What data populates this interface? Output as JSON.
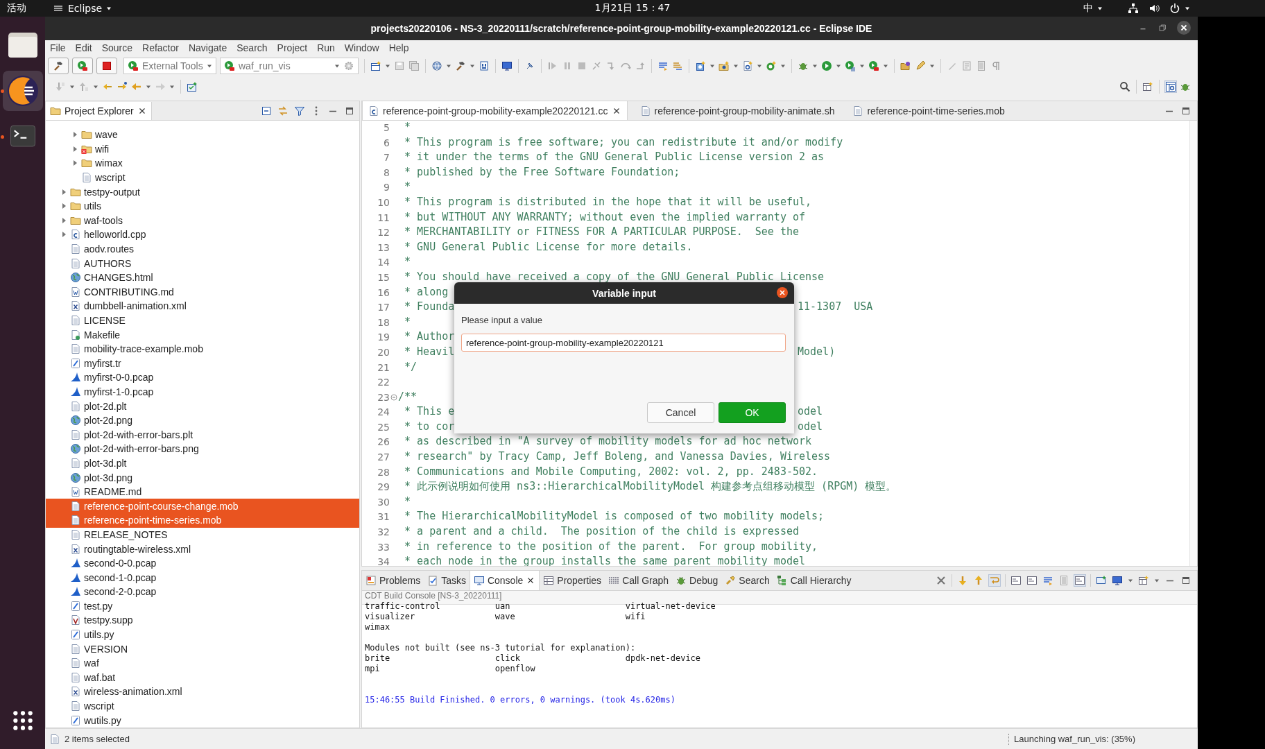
{
  "topbar": {
    "activities": "活动",
    "app": "Eclipse",
    "clock": "1月21日 15：47",
    "input_method": "中"
  },
  "window": {
    "title": "projects20220106 - NS-3_20220111/scratch/reference-point-group-mobility-example20220121.cc - Eclipse IDE"
  },
  "menu": [
    "File",
    "Edit",
    "Source",
    "Refactor",
    "Navigate",
    "Search",
    "Project",
    "Run",
    "Window",
    "Help"
  ],
  "toolbar": {
    "external_tools": "External Tools",
    "launch_config": "waf_run_vis"
  },
  "explorer": {
    "title": "Project Explorer",
    "tree": [
      {
        "children": [
          {
            "label": "wave",
            "kind": "folder",
            "expanded": false,
            "selected": false
          },
          {
            "label": "wifi",
            "kind": "folder_error",
            "expanded": false,
            "selected": false
          },
          {
            "label": "wimax",
            "kind": "folder",
            "expanded": false,
            "selected": false
          },
          {
            "label": "wscript",
            "kind": "file",
            "selected": false
          }
        ]
      },
      {
        "label": "testpy-output",
        "kind": "folder",
        "expanded": false,
        "selected": false
      },
      {
        "label": "utils",
        "kind": "folder",
        "expanded": false,
        "selected": false
      },
      {
        "label": "waf-tools",
        "kind": "folder",
        "expanded": false,
        "selected": false
      },
      {
        "label": "helloworld.cpp",
        "kind": "c_file",
        "expanded": false,
        "selected": false
      },
      {
        "label": "aodv.routes",
        "kind": "file",
        "selected": false
      },
      {
        "label": "AUTHORS",
        "kind": "file",
        "selected": false
      },
      {
        "label": "CHANGES.html",
        "kind": "web",
        "selected": false
      },
      {
        "label": "CONTRIBUTING.md",
        "kind": "doc",
        "selected": false
      },
      {
        "label": "dumbbell-animation.xml",
        "kind": "xml",
        "selected": false
      },
      {
        "label": "LICENSE",
        "kind": "file",
        "selected": false
      },
      {
        "label": "Makefile",
        "kind": "make",
        "selected": false
      },
      {
        "label": "mobility-trace-example.mob",
        "kind": "file",
        "selected": false
      },
      {
        "label": "myfirst.tr",
        "kind": "script",
        "selected": false
      },
      {
        "label": "myfirst-0-0.pcap",
        "kind": "pcap",
        "selected": false
      },
      {
        "label": "myfirst-1-0.pcap",
        "kind": "pcap",
        "selected": false
      },
      {
        "label": "plot-2d.plt",
        "kind": "file",
        "selected": false
      },
      {
        "label": "plot-2d.png",
        "kind": "web",
        "selected": false
      },
      {
        "label": "plot-2d-with-error-bars.plt",
        "kind": "file",
        "selected": false
      },
      {
        "label": "plot-2d-with-error-bars.png",
        "kind": "web",
        "selected": false
      },
      {
        "label": "plot-3d.plt",
        "kind": "file",
        "selected": false
      },
      {
        "label": "plot-3d.png",
        "kind": "web",
        "selected": false
      },
      {
        "label": "README.md",
        "kind": "doc",
        "selected": false
      },
      {
        "label": "reference-point-course-change.mob",
        "kind": "file",
        "selected": true
      },
      {
        "label": "reference-point-time-series.mob",
        "kind": "file",
        "selected": true
      },
      {
        "label": "RELEASE_NOTES",
        "kind": "file",
        "selected": false
      },
      {
        "label": "routingtable-wireless.xml",
        "kind": "xml",
        "selected": false
      },
      {
        "label": "second-0-0.pcap",
        "kind": "pcap",
        "selected": false
      },
      {
        "label": "second-1-0.pcap",
        "kind": "pcap",
        "selected": false
      },
      {
        "label": "second-2-0.pcap",
        "kind": "pcap",
        "selected": false
      },
      {
        "label": "test.py",
        "kind": "script",
        "selected": false
      },
      {
        "label": "testpy.supp",
        "kind": "supp",
        "selected": false
      },
      {
        "label": "utils.py",
        "kind": "script",
        "selected": false
      },
      {
        "label": "VERSION",
        "kind": "file",
        "selected": false
      },
      {
        "label": "waf",
        "kind": "file",
        "selected": false
      },
      {
        "label": "waf.bat",
        "kind": "file",
        "selected": false
      },
      {
        "label": "wireless-animation.xml",
        "kind": "xml",
        "selected": false
      },
      {
        "label": "wscript",
        "kind": "file",
        "selected": false
      },
      {
        "label": "wutils.py",
        "kind": "script",
        "selected": false
      }
    ]
  },
  "editor": {
    "tabs": [
      {
        "label": "reference-point-group-mobility-example20220121.cc",
        "kind": "c_file",
        "selected": true
      },
      {
        "label": "reference-point-group-mobility-animate.sh",
        "kind": "text_file",
        "selected": false
      },
      {
        "label": "reference-point-time-series.mob",
        "kind": "text_file",
        "selected": false
      }
    ],
    "lines": [
      {
        "number": "5",
        "text": " *"
      },
      {
        "number": "6",
        "text": " * This program is free software; you can redistribute it and/or modify"
      },
      {
        "number": "7",
        "text": " * it under the terms of the GNU General Public License version 2 as"
      },
      {
        "number": "8",
        "text": " * published by the Free Software Foundation;"
      },
      {
        "number": "9",
        "text": " *"
      },
      {
        "number": "10",
        "text": " * This program is distributed in the hope that it will be useful,"
      },
      {
        "number": "11",
        "text": " * but WITHOUT ANY WARRANTY; without even the implied warranty of"
      },
      {
        "number": "12",
        "text": " * MERCHANTABILITY or FITNESS FOR A PARTICULAR PURPOSE.  See the"
      },
      {
        "number": "13",
        "text": " * GNU General Public License for more details."
      },
      {
        "number": "14",
        "text": " *"
      },
      {
        "number": "15",
        "text": " * You should have received a copy of the GNU General Public License"
      },
      {
        "number": "16",
        "text": " * along"
      },
      {
        "number": "17",
        "text": " * Founda",
        "right": "11-1307  USA"
      },
      {
        "number": "18",
        "text": " *"
      },
      {
        "number": "19",
        "text": " * Author"
      },
      {
        "number": "20",
        "text": " * Heavil",
        "right": "Model)"
      },
      {
        "number": "21",
        "text": " */"
      },
      {
        "number": "22"
      },
      {
        "number": "23",
        "text": "/**",
        "fold": true
      },
      {
        "number": "24",
        "text": " * This e",
        "right": "odel"
      },
      {
        "number": "25",
        "text": " * to cor",
        "right": "odel"
      },
      {
        "number": "26",
        "text": " * as described in \"A survey of mobility models for ad hoc network"
      },
      {
        "number": "27",
        "text": " * research\" by Tracy Camp, Jeff Boleng, and Vanessa Davies, Wireless"
      },
      {
        "number": "28",
        "text": " * Communications and Mobile Computing, 2002: vol. 2, pp. 2483-502."
      },
      {
        "number": "29",
        "text": " * 此示例说明如何使用 ns3::HierarchicalMobilityModel 构建参考点组移动模型 (RPGM) 模型。"
      },
      {
        "number": "30",
        "text": " *"
      },
      {
        "number": "31",
        "text": " * The HierarchicalMobilityModel is composed of two mobility models;"
      },
      {
        "number": "32",
        "text": " * a parent and a child.  The position of the child is expressed"
      },
      {
        "number": "33",
        "text": " * in reference to the position of the parent.  For group mobility,"
      },
      {
        "number": "34",
        "text": " * each node in the group installs the same parent mobility model"
      }
    ]
  },
  "bottom_panel": {
    "tabs": [
      {
        "label": "Problems",
        "kind": "problems",
        "selected": false
      },
      {
        "label": "Tasks",
        "kind": "tasks",
        "selected": false
      },
      {
        "label": "Console",
        "kind": "console",
        "selected": true
      },
      {
        "label": "Properties",
        "kind": "properties",
        "selected": false
      },
      {
        "label": "Call Graph",
        "kind": "call_graph",
        "selected": false
      },
      {
        "label": "Debug",
        "kind": "debug",
        "selected": false
      },
      {
        "label": "Search",
        "kind": "search",
        "selected": false
      },
      {
        "label": "Call Hierarchy",
        "kind": "call_hierarchy",
        "selected": false
      }
    ],
    "console_title": "CDT Build Console [NS-3_20220111]",
    "output": [
      {
        "kind": "plain",
        "lines": [
          "traffic-control           uan                       virtual-net-device",
          "visualizer                wave                      wifi",
          "wimax"
        ]
      },
      {
        "kind": "plain",
        "lines": [
          "Modules not built (see ns-3 tutorial for explanation):",
          "brite                     click                     dpdk-net-device",
          "mpi                       openflow"
        ]
      },
      {
        "kind": "status",
        "lines": [
          "15:46:55 Build Finished. 0 errors, 0 warnings. (took 4s.620ms)"
        ]
      }
    ]
  },
  "status_bar": {
    "selection": "2 items selected",
    "job": "Launching waf_run_vis: (35%)"
  },
  "dialog": {
    "title": "Variable input",
    "prompt": "Please input a value",
    "value": "reference-point-group-mobility-example20220121",
    "buttons": [
      {
        "label": "Cancel",
        "kind": "secondary"
      },
      {
        "label": "OK",
        "kind": "primary"
      }
    ]
  }
}
